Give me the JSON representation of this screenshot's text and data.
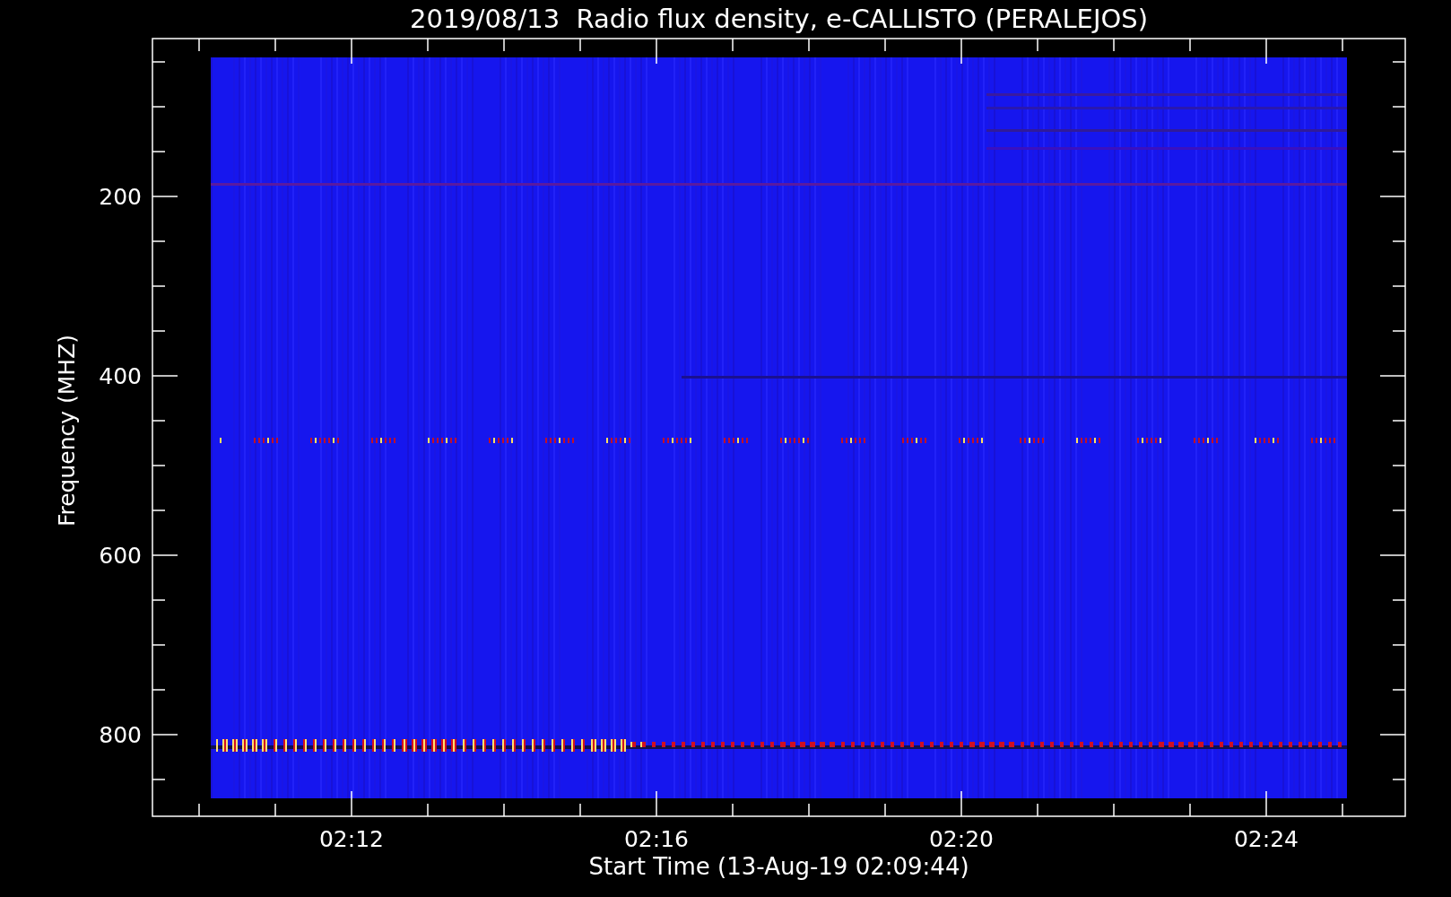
{
  "plot": {
    "title": "2019/08/13  Radio flux density, e-CALLISTO (PERALEJOS)",
    "ylabel": "Frequency (MHZ)",
    "xlabel": "Start Time (13-Aug-19 02:09:44)",
    "yticks": [
      "200",
      "400",
      "600",
      "800"
    ],
    "xticks": [
      "02:12",
      "02:16",
      "02:20",
      "02:24"
    ]
  }
}
